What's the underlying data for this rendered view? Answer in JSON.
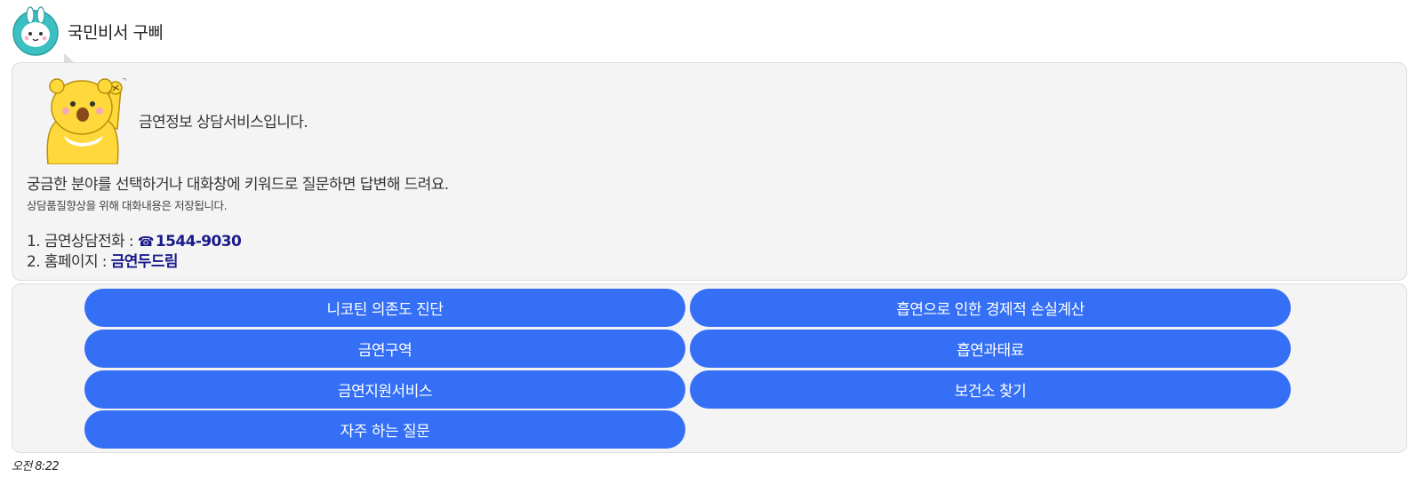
{
  "bot": {
    "name": "국민비서 구삐"
  },
  "message": {
    "intro": "금연정보 상담서비스입니다.",
    "guide": "궁금한 분야를 선택하거나 대화창에 키워드로 질문하면 답변해 드려요.",
    "notice": "상담품질향상을 위해 대화내용은 저장됩니다.",
    "info": [
      {
        "prefix": "1. 금연상담전화 : ",
        "icon": "☎",
        "value": "1544-9030"
      },
      {
        "prefix": "2. 홈페이지 : ",
        "value": "금연두드림"
      }
    ]
  },
  "quick_replies": [
    "니코틴 의존도 진단",
    "흡연으로 인한 경제적 손실계산",
    "금연구역",
    "흡연과태료",
    "금연지원서비스",
    "보건소 찾기",
    "자주 하는 질문"
  ],
  "timestamp": "오전 8:22",
  "colors": {
    "button_bg": "#346ff5",
    "button_text": "#ffffff",
    "bubble_bg": "#f4f4f4",
    "highlight_text": "#1a1a8c",
    "avatar_teal": "#3bbfc1",
    "bear_yellow": "#ffd93b"
  },
  "icons": {
    "avatar": "rabbit-mascot-icon",
    "bear": "bear-mascot-icon",
    "phone": "phone-icon"
  }
}
